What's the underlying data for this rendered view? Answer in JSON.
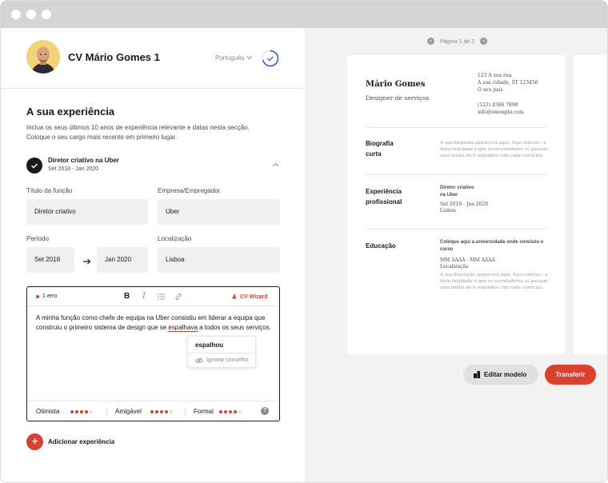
{
  "colors": {
    "accent": "#d9412e",
    "dark": "#1a1a1a",
    "panel": "#f2f2f2",
    "field": "#f0f0f0"
  },
  "header": {
    "cv_title": "CV Mário Gomes 1",
    "language": "Português",
    "completion": 0.7
  },
  "experience": {
    "title": "A sua experiência",
    "description": "Inclua os seus últimos 10 anos de experiência relevante e datas nesta secção. Coloque o seu cargo mais recente em primeiro lugar.",
    "job": {
      "title": "Diretor criativo na Uber",
      "dates": "Set 2018 - Jan 2020"
    },
    "fields": {
      "job_title_label": "Título da função",
      "job_title_value": "Diretor criativo",
      "employer_label": "Empresa/Empregador",
      "employer_value": "Uber",
      "period_label": "Período",
      "start_value": "Set 2018",
      "end_value": "Jan 2020",
      "location_label": "Localização",
      "location_value": "Lisboa"
    },
    "add_label": "Adicionar experiência",
    "add_symbol": "+"
  },
  "editor": {
    "error_count": "1 erro",
    "bold": "B",
    "italic": "I",
    "wizard": "CV Wizard",
    "text_before": "A minha função como chefe de equipa na Uber consistiu em liderar a equipa que construiu o primeiro sistema de design que se ",
    "text_error": "espalhava",
    "text_after": " a todos os seus serviços.",
    "suggestion": "espalhou",
    "ignore": "Ignorar conselho",
    "tones": [
      {
        "label": "Otimista",
        "level": 4
      },
      {
        "label": "Amigável",
        "level": 4
      },
      {
        "label": "Formal",
        "level": 4
      }
    ],
    "help": "?"
  },
  "preview": {
    "pager": "Página 1 de 2",
    "name": "Mário Gomes",
    "role": "Designer de serviços",
    "address": [
      "123 A sua rua",
      "A sua cidade, ST 123456",
      "O seu país"
    ],
    "contact": [
      "(123) 4566 7890",
      "info@exemplo.com"
    ],
    "bio_heading": [
      "Biografia",
      "curta"
    ],
    "bio_text": "A sua biografia aparecerá aqui. Seja conciso - a dura realidade é que os recrutadores só passam uma média de 6 segundos com cada currículo.",
    "exp_heading": [
      "Experiência",
      "profissional"
    ],
    "exp_job": [
      "Diretor criativo",
      "na Uber"
    ],
    "exp_dates": "Set 2018 - Jan 2020",
    "exp_location": "Lisboa",
    "edu_heading": "Educação",
    "edu_school": "Coloque aqui a universidade onde concluiu o curso",
    "edu_dates": "MM AAAA - MM AAAA",
    "edu_location": "Localização",
    "edu_text": "A sua descrição aparecerá aqui. Seja conciso - a dura realidade é que os recrutadores só passam uma média de 6 segundos com cada currículo."
  },
  "actions": {
    "edit_template": "Editar modelo",
    "download": "Transferir"
  }
}
